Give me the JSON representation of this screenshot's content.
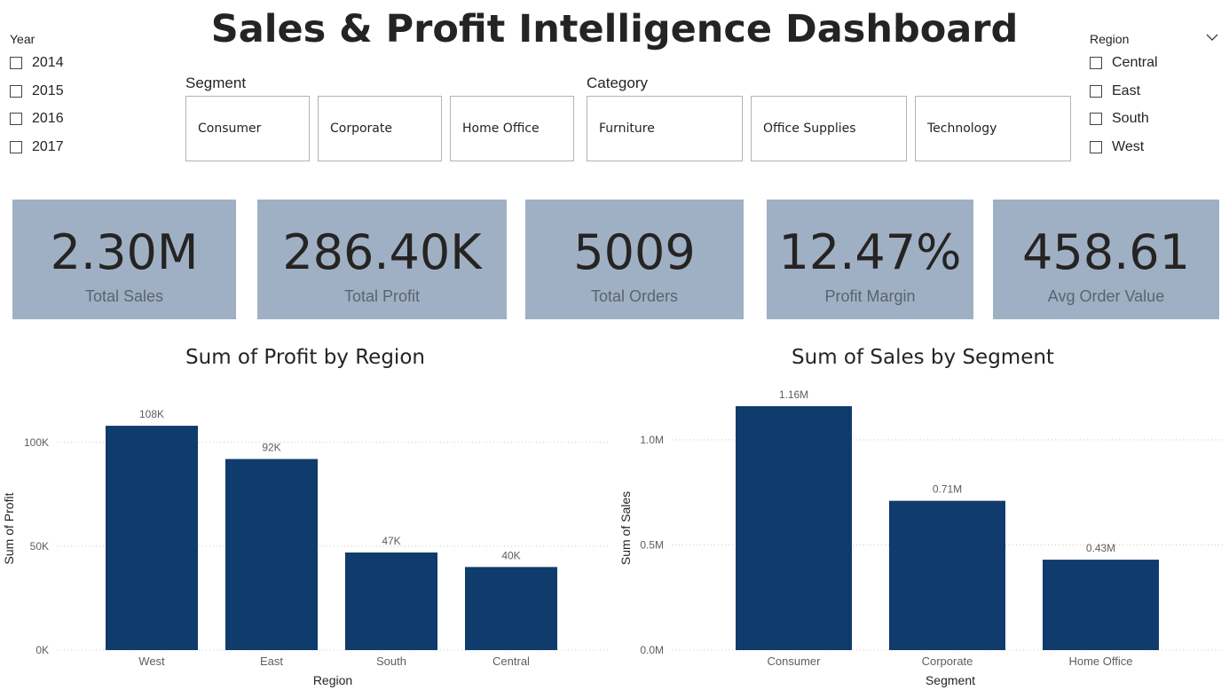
{
  "title": "Sales & Profit Intelligence Dashboard",
  "year_slicer": {
    "title": "Year",
    "options": [
      "2014",
      "2015",
      "2016",
      "2017"
    ]
  },
  "region_slicer": {
    "title": "Region",
    "options": [
      "Central",
      "East",
      "South",
      "West"
    ]
  },
  "segment_slicer": {
    "title": "Segment",
    "tiles": [
      "Consumer",
      "Corporate",
      "Home Office"
    ]
  },
  "category_slicer": {
    "title": "Category",
    "tiles": [
      "Furniture",
      "Office Supplies",
      "Technology"
    ]
  },
  "kpis": [
    {
      "value": "2.30M",
      "label": "Total Sales"
    },
    {
      "value": "286.40K",
      "label": "Total Profit"
    },
    {
      "value": "5009",
      "label": "Total Orders"
    },
    {
      "value": "12.47%",
      "label": "Profit Margin"
    },
    {
      "value": "458.61",
      "label": "Avg Order Value"
    }
  ],
  "colors": {
    "kpi_bg": "#a0b0c4",
    "bar": "#0f3b6d",
    "grid": "#c8c8c8"
  },
  "chart_data": [
    {
      "type": "bar",
      "title": "Sum of Profit by Region",
      "xlabel": "Region",
      "ylabel": "Sum of Profit",
      "categories": [
        "West",
        "East",
        "South",
        "Central"
      ],
      "values": [
        108,
        92,
        47,
        40
      ],
      "data_labels": [
        "108K",
        "92K",
        "47K",
        "40K"
      ],
      "yticks": [
        0,
        50,
        100
      ],
      "ytick_labels": [
        "0K",
        "50K",
        "100K"
      ],
      "ylim": [
        0,
        117
      ],
      "grid": true
    },
    {
      "type": "bar",
      "title": "Sum of Sales by Segment",
      "xlabel": "Segment",
      "ylabel": "Sum of Sales",
      "categories": [
        "Consumer",
        "Corporate",
        "Home Office"
      ],
      "values": [
        1.16,
        0.71,
        0.43
      ],
      "data_labels": [
        "1.16M",
        "0.71M",
        "0.43M"
      ],
      "yticks": [
        0,
        0.5,
        1.0
      ],
      "ytick_labels": [
        "0.0M",
        "0.5M",
        "1.0M"
      ],
      "ylim": [
        0,
        1.16
      ],
      "grid": true
    }
  ]
}
